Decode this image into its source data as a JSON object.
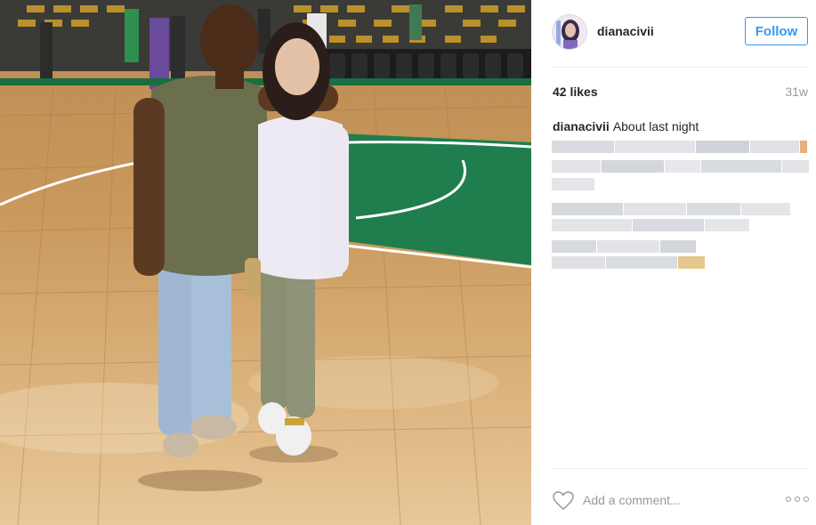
{
  "post": {
    "username": "dianacivii",
    "follow_label": "Follow",
    "likes": "42 likes",
    "age": "31w",
    "caption_username": "dianacivii",
    "caption_text": "About last night",
    "comment_placeholder": "Add a comment..."
  },
  "icons": {
    "heart": "heart-icon",
    "more": "more-options-icon",
    "avatar": "profile-avatar"
  },
  "colors": {
    "follow_blue": "#3897f0",
    "court_green": "#1f7d4e",
    "wood": "#c9985c"
  }
}
